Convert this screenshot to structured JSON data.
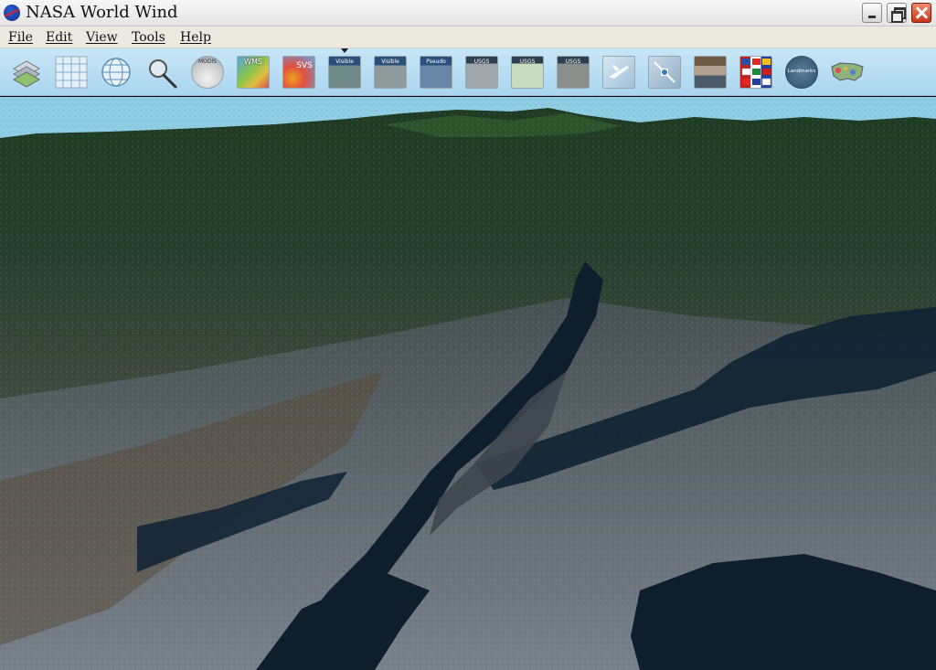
{
  "window": {
    "title": "NASA World Wind",
    "logo_text": "NASA"
  },
  "menu": {
    "items": [
      {
        "label": "File"
      },
      {
        "label": "Edit"
      },
      {
        "label": "View"
      },
      {
        "label": "Tools"
      },
      {
        "label": "Help"
      }
    ]
  },
  "toolbar": {
    "buttons": [
      {
        "name": "layer-manager-icon",
        "label": ""
      },
      {
        "name": "grid-lines-icon",
        "label": ""
      },
      {
        "name": "globe-icon",
        "label": ""
      },
      {
        "name": "search-icon",
        "label": ""
      },
      {
        "name": "rapid-fire-modis-icon",
        "label": "MODIS"
      },
      {
        "name": "wms-browser-icon",
        "label": "WMS"
      },
      {
        "name": "svs-icon",
        "label": "SVS"
      },
      {
        "name": "landsat7-visible-icon",
        "label": "Visible"
      },
      {
        "name": "landsat7-visible-wms-icon",
        "label": "Visible"
      },
      {
        "name": "landsat7-pseudo-icon",
        "label": "Pseudo"
      },
      {
        "name": "usgs-urban-icon",
        "label": "USGS"
      },
      {
        "name": "usgs-topo-icon",
        "label": "USGS"
      },
      {
        "name": "usgs-imagery-icon",
        "label": "USGS"
      },
      {
        "name": "place-finder-icon",
        "label": ""
      },
      {
        "name": "scale-bar-icon",
        "label": ""
      },
      {
        "name": "animated-earth-icon",
        "label": ""
      },
      {
        "name": "flags-icon",
        "label": ""
      },
      {
        "name": "landmarks-icon",
        "label": "Landmarks"
      },
      {
        "name": "us-boundaries-icon",
        "label": ""
      }
    ]
  },
  "colors": {
    "sky": "#8fcfe6",
    "toolbar": "#b6dcf1",
    "menubar": "#ece9e0"
  }
}
